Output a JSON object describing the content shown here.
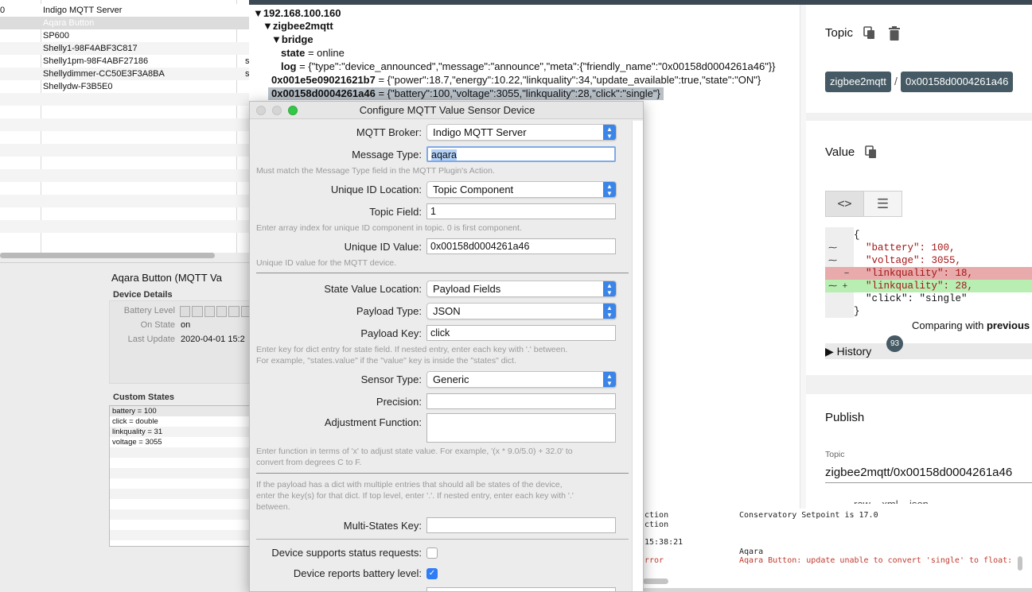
{
  "device_table": {
    "rows": [
      {
        "col1": "0",
        "name": "Indigo MQTT Server",
        "col3": ""
      },
      {
        "col1": "",
        "name": "Aqara Button",
        "col3": "",
        "selected": true
      },
      {
        "col1": "",
        "name": "SP600",
        "col3": ""
      },
      {
        "col1": "",
        "name": "Shelly1-98F4ABF3C817",
        "col3": ""
      },
      {
        "col1": "",
        "name": "Shelly1pm-98F4ABF27186",
        "col3": "s"
      },
      {
        "col1": "",
        "name": "Shellydimmer-CC50E3F3A8BA",
        "col3": "sh"
      },
      {
        "col1": "",
        "name": "Shellydw-F3B5E0",
        "col3": ""
      }
    ]
  },
  "device_info": {
    "title": "Aqara Button (MQTT Va",
    "details_header": "Device Details",
    "battery_label": "Battery Level",
    "on_state_label": "On State",
    "on_state_value": "on",
    "last_update_label": "Last Update",
    "last_update_value": "2020-04-01 15:2",
    "custom_states_header": "Custom States",
    "custom_states": [
      "battery = 100",
      "click = double",
      "linkquality = 31",
      "voltage = 3055"
    ]
  },
  "tree": {
    "root": "192.168.100.160",
    "zigbee": "zigbee2mqtt",
    "bridge": "bridge",
    "state_key": "state",
    "state_value": " = online",
    "log_key": "log",
    "log_value": " = {\"type\":\"device_announced\",\"message\":\"announce\",\"meta\":{\"friendly_name\":\"0x00158d0004261a46\"}}",
    "dev1_key": "0x001e5e09021621b7",
    "dev1_value": " = {\"power\":18.7,\"energy\":10.22,\"linkquality\":34,\"update_available\":true,\"state\":\"ON\"}",
    "dev2_key": "0x00158d0004261a46",
    "dev2_value": " = {\"battery\":100,\"voltage\":3055,\"linkquality\":28,\"click\":\"single\"}"
  },
  "right_panel": {
    "topic_label": "Topic",
    "topic_chip1": "zigbee2mqtt",
    "topic_sep": "/",
    "topic_chip2": "0x00158d0004261a46",
    "value_label": "Value",
    "code_lines": [
      {
        "gutter": "",
        "text": "{",
        "style": "normal"
      },
      {
        "gutter": "⁓",
        "text": "  \"battery\": 100,",
        "style": "normal"
      },
      {
        "gutter": "⁓",
        "text": "  \"voltage\": 3055,",
        "style": "normal"
      },
      {
        "gutter": "   −",
        "text": "  \"linkquality\": 18,",
        "style": "removed"
      },
      {
        "gutter": "⁓ +",
        "text": "  \"linkquality\": 28,",
        "style": "added"
      },
      {
        "gutter": "",
        "text": "  \"click\": \"single\"",
        "style": "normal"
      },
      {
        "gutter": "",
        "text": "}",
        "style": "normal"
      }
    ],
    "comparing_prefix": "Comparing with ",
    "comparing_bold": "previous",
    "history_label": "History",
    "history_count": "93",
    "publish_label": "Publish",
    "publish_topic_label": "Topic",
    "publish_topic_value": "zigbee2mqtt/0x00158d0004261a46",
    "publish_format_row": "raw    xml    json",
    "colors": {
      "removed": "#e8aaaa",
      "added": "#b8eeb2",
      "chip": "#455a64"
    }
  },
  "log": {
    "lines": [
      {
        "left": "ction",
        "right": "Conservatory Setpoint is 17.0",
        "color": "#222"
      },
      {
        "left": "ction",
        "right": "",
        "color": "#222"
      },
      {
        "left": "15:38:21",
        "right": "",
        "color": "#222"
      },
      {
        "left": "",
        "right": "Aqara",
        "color": "#222"
      },
      {
        "left": "rror",
        "right": "Aqara Button: update unable to convert 'single' to float:",
        "color": "#c0392b"
      }
    ]
  },
  "dialog": {
    "title": "Configure MQTT Value Sensor Device",
    "broker_label": "MQTT Broker:",
    "broker_value": "Indigo MQTT Server",
    "msgtype_label": "Message Type:",
    "msgtype_value": "aqara",
    "msgtype_help": "Must match the Message Type field in the MQTT Plugin's Action.",
    "uid_loc_label": "Unique ID Location:",
    "uid_loc_value": "Topic Component",
    "topic_field_label": "Topic Field:",
    "topic_field_value": "1",
    "topic_field_help": "Enter array index for unique ID component in topic.  0 is first component.",
    "uid_value_label": "Unique ID Value:",
    "uid_value_value": "0x00158d0004261a46",
    "uid_value_help": "Unique ID value for the MQTT device.",
    "state_loc_label": "State Value Location:",
    "state_loc_value": "Payload Fields",
    "payload_type_label": "Payload Type:",
    "payload_type_value": "JSON",
    "payload_key_label": "Payload Key:",
    "payload_key_value": "click",
    "payload_key_help1": "Enter key for dict entry for state field.  If nested entry, enter each key with '.' between.",
    "payload_key_help2": "For example, \"states.value\" if the \"value\" key is inside the \"states\" dict.",
    "sensor_type_label": "Sensor Type:",
    "sensor_type_value": "Generic",
    "precision_label": "Precision:",
    "precision_value": "",
    "adjust_label": "Adjustment Function:",
    "adjust_value": "",
    "adjust_help1": "Enter function in terms of 'x' to adjust state value. For example, '(x * 9.0/5.0) + 32.0' to",
    "adjust_help2": "convert from degrees C to F.",
    "multi_help1": "If the payload has a dict with multiple entries that should all be states of the device,",
    "multi_help2": "enter the key(s) for that dict.  If top level, enter '.'.  If nested entry, enter each key with '.'",
    "multi_help3": "between.",
    "multi_label": "Multi-States Key:",
    "multi_value": "",
    "status_req_label": "Device supports status requests:",
    "status_req_checked": false,
    "battery_label": "Device reports battery level:",
    "battery_checked": true
  }
}
